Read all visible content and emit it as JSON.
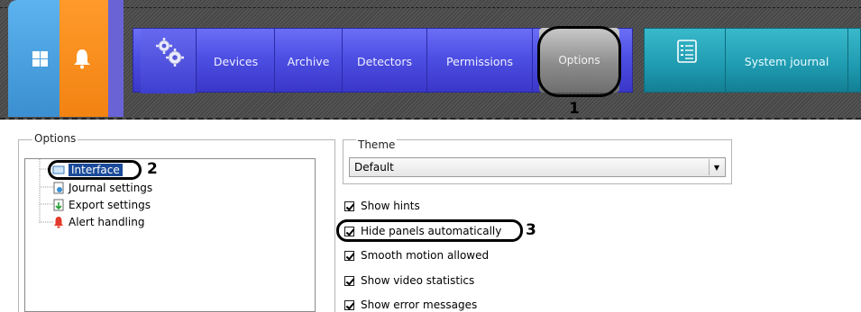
{
  "toolbar": {
    "home_icon": "windows-grid-icon",
    "alerts_icon": "bell-icon",
    "settings_icon": "gears-icon",
    "menu": [
      "Devices",
      "Archive",
      "Detectors",
      "Permissions",
      "Options"
    ],
    "journal_icon": "checklist-icon",
    "journal_label": "System journal"
  },
  "annotations": {
    "n1": "1",
    "n2": "2",
    "n3": "3"
  },
  "options_panel": {
    "legend": "Options",
    "tree": [
      "Interface",
      "Journal settings",
      "Export settings",
      "Alert handling"
    ],
    "selected": "Interface"
  },
  "theme": {
    "legend": "Theme",
    "value": "Default"
  },
  "checkboxes": [
    {
      "label": "Show hints",
      "checked": true
    },
    {
      "label": "Hide panels automatically",
      "checked": true
    },
    {
      "label": "Smooth motion allowed",
      "checked": true
    },
    {
      "label": "Show video statistics",
      "checked": true
    },
    {
      "label": "Show error messages",
      "checked": true
    }
  ],
  "colors": {
    "menubar": "#4d4fe4",
    "journal": "#1f9ab0",
    "home_tile": "#4aa3e2",
    "alert_tile": "#f28312"
  }
}
